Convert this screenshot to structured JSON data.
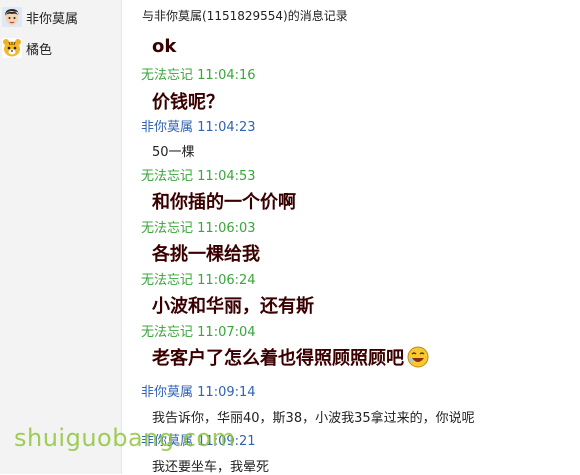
{
  "sidebar": {
    "contacts": [
      {
        "name": "非你莫属",
        "avatar": "cartoon-face-avatar"
      },
      {
        "name": "橘色",
        "avatar": "tiger-avatar"
      }
    ]
  },
  "header": {
    "title": "与非你莫属(1151829554)的消息记录"
  },
  "messages": [
    {
      "sender": "",
      "time": "",
      "text": "ok"
    },
    {
      "sender": "无法忘记",
      "time": "11:04:16",
      "text": "价钱呢？"
    },
    {
      "sender": "非你莫属",
      "time": "11:04:23",
      "text": "50一棵"
    },
    {
      "sender": "无法忘记",
      "time": "11:04:53",
      "text": "和你插的一个价啊"
    },
    {
      "sender": "无法忘记",
      "time": "11:06:03",
      "text": "各挑一棵给我"
    },
    {
      "sender": "无法忘记",
      "time": "11:06:24",
      "text": "小波和华丽，还有斯"
    },
    {
      "sender": "无法忘记",
      "time": "11:07:04",
      "text": "老客户了怎么着也得照顾照顾吧",
      "emoji": "laughing-emoji"
    },
    {
      "sender": "非你莫属",
      "time": "11:09:14",
      "text": "我告诉你，华丽40，斯38，小波我35拿过来的，你说呢"
    },
    {
      "sender": "非你莫属",
      "time": "11:09:21",
      "text": "我还要坐车，我晕死"
    }
  ],
  "watermark": {
    "text": "shuiguobang.com"
  },
  "colors": {
    "me": "#3aa53a",
    "peer": "#2f63b5",
    "body": "#3a0000",
    "watermark": "#90c63a"
  }
}
